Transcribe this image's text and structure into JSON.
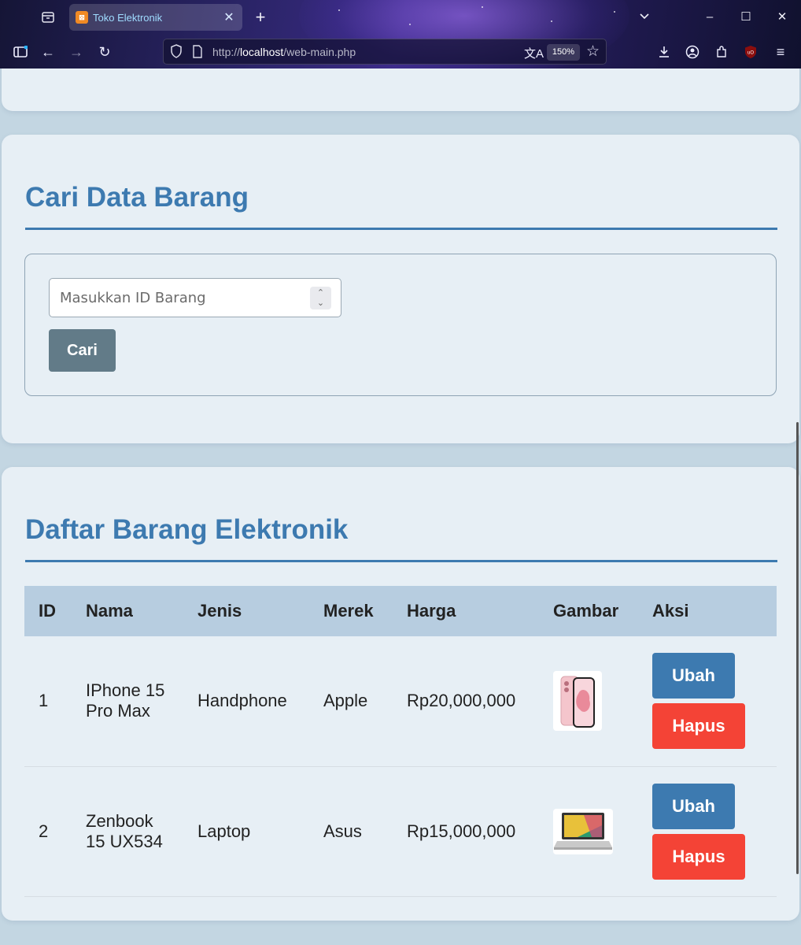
{
  "browser": {
    "tab_title": "Toko Elektronik",
    "url_prefix": "http://",
    "url_host": "localhost",
    "url_path": "/web-main.php",
    "zoom": "150%"
  },
  "search": {
    "title": "Cari Data Barang",
    "placeholder": "Masukkan ID Barang",
    "button": "Cari"
  },
  "list": {
    "title": "Daftar Barang Elektronik",
    "headers": [
      "ID",
      "Nama",
      "Jenis",
      "Merek",
      "Harga",
      "Gambar",
      "Aksi"
    ],
    "rows": [
      {
        "id": "1",
        "nama": "IPhone 15 Pro Max",
        "jenis": "Handphone",
        "merek": "Apple",
        "harga": "Rp20,000,000",
        "gambar": "phone-image",
        "ubah": "Ubah",
        "hapus": "Hapus"
      },
      {
        "id": "2",
        "nama": "Zenbook 15 UX534",
        "jenis": "Laptop",
        "merek": "Asus",
        "harga": "Rp15,000,000",
        "gambar": "laptop-image",
        "ubah": "Ubah",
        "hapus": "Hapus"
      }
    ]
  },
  "colors": {
    "accent": "#3d7ab0",
    "danger": "#f44336",
    "search_button": "#627b88",
    "header_bg": "#b7cde0",
    "card_bg": "#e7eff5",
    "page_bg": "#c3d6e2"
  }
}
